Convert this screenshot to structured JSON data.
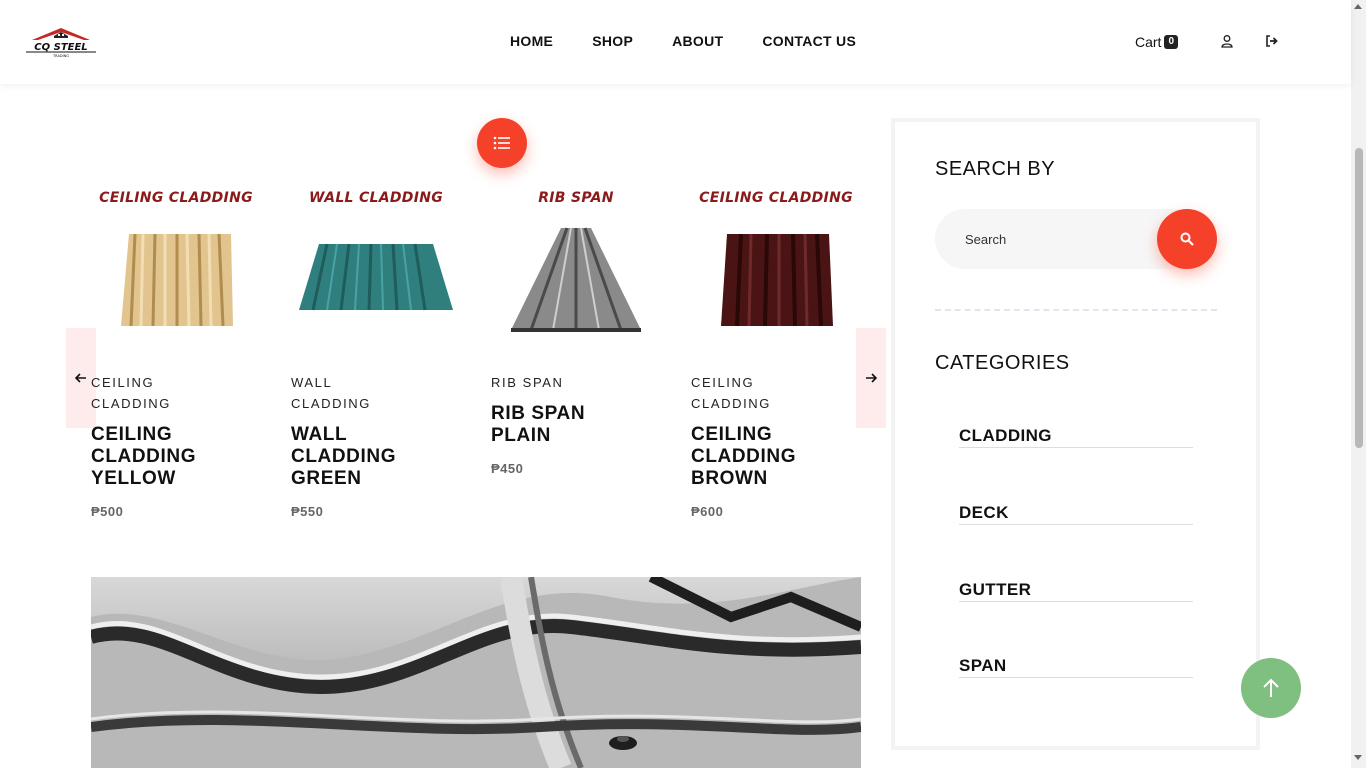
{
  "header": {
    "logo_text": "CQ STEEL",
    "logo_subtext": "TRADING",
    "nav": [
      "HOME",
      "SHOP",
      "ABOUT",
      "CONTACT US"
    ],
    "cart_label": "Cart",
    "cart_count": "0"
  },
  "products": [
    {
      "image_title": "CEILING CLADDING",
      "category": "CEILING CLADDING",
      "name": "CEILING CLADDING YELLOW",
      "price": "₱500",
      "color": "#e2c48e"
    },
    {
      "image_title": "WALL CLADDING",
      "category": "WALL CLADDING",
      "name": "WALL CLADDING GREEN",
      "price": "₱550",
      "color": "#2f7f7f"
    },
    {
      "image_title": "RIB SPAN",
      "category": "RIB SPAN",
      "name": "RIB SPAN PLAIN",
      "price": "₱450",
      "color": "#7a7a7a"
    },
    {
      "image_title": "CEILING CLADDING",
      "category": "CEILING CLADDING",
      "name": "CEILING CLADDING BROWN",
      "price": "₱600",
      "color": "#4a1414"
    }
  ],
  "sidebar": {
    "search_title": "SEARCH BY",
    "search_placeholder": "Search",
    "categories_title": "CATEGORIES",
    "categories": [
      "CLADDING",
      "DECK",
      "GUTTER",
      "SPAN"
    ]
  },
  "colors": {
    "accent": "#f5412a",
    "to_top": "#7fbf7f",
    "title_red": "#8b1a1a"
  },
  "icons": [
    "list-icon",
    "arrow-left-icon",
    "arrow-right-icon",
    "search-icon",
    "user-icon",
    "logout-icon",
    "arrow-up-icon"
  ]
}
